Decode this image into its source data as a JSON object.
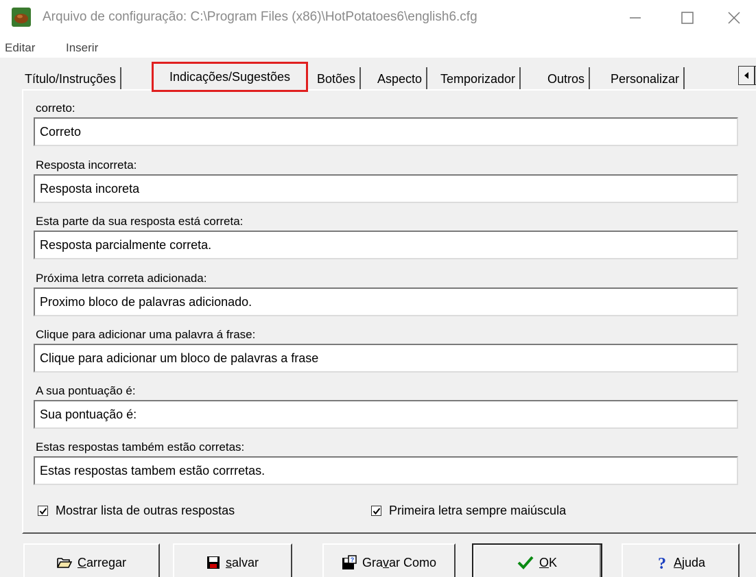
{
  "window": {
    "title": "Arquivo de configuração: C:\\Program Files (x86)\\HotPotatoes6\\english6.cfg"
  },
  "menu": {
    "items": [
      "Editar",
      "Inserir"
    ]
  },
  "tabs": {
    "items": [
      "Título/Instruções",
      "Indicações/Sugestões",
      "Botões",
      "Aspecto",
      "Temporizador",
      "Outros",
      "Personalizar"
    ],
    "active": "Indicações/Sugestões",
    "active_highlight_color": "#e02020"
  },
  "fields": [
    {
      "label": "correto:",
      "value": "Correto"
    },
    {
      "label": "Resposta incorreta:",
      "value": "Resposta incoreta"
    },
    {
      "label": "Esta parte da sua resposta está correta:",
      "value": "Resposta parcialmente correta."
    },
    {
      "label": "Próxima letra correta adicionada:",
      "value": "Proximo bloco de palavras adicionado."
    },
    {
      "label": "Clique para adicionar uma palavra á frase:",
      "value": "Clique para adicionar um bloco de palavras a frase"
    },
    {
      "label": "A sua pontuação é:",
      "value": "Sua pontuação é:"
    },
    {
      "label": "Estas respostas também estão corretas:",
      "value": "Estas respostas tambem estão corrretas."
    }
  ],
  "checkboxes": [
    {
      "label": "Mostrar lista de outras respostas",
      "checked": true
    },
    {
      "label": "Primeira letra sempre maiúscula",
      "checked": true
    }
  ],
  "buttons": {
    "carregar": {
      "mnemonic": "C",
      "rest": "arregar"
    },
    "salvar": {
      "mnemonic": "s",
      "rest": "alvar"
    },
    "gravar": {
      "before": "Gra",
      "mnemonic": "v",
      "after": "ar Como"
    },
    "ok": {
      "mnemonic": "O",
      "rest": "K"
    },
    "ajuda": {
      "mnemonic": "A",
      "rest": "juda"
    }
  }
}
